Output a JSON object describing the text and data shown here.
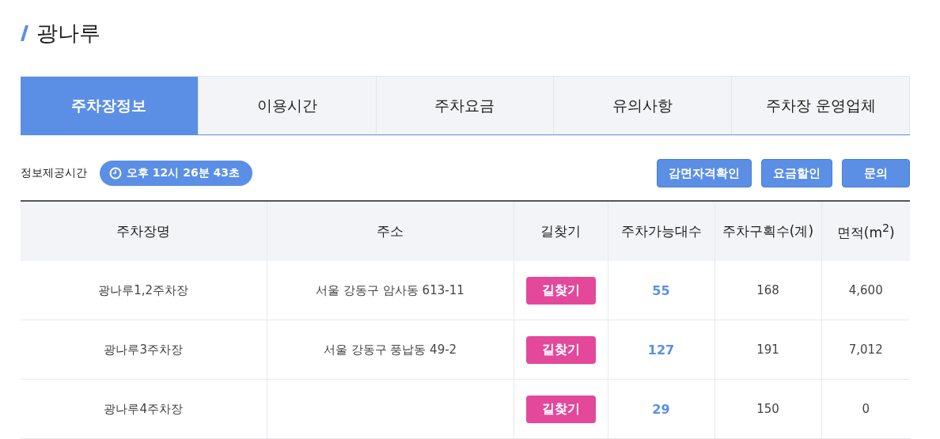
{
  "title": "광나루",
  "tabs": [
    {
      "label": "주차장정보",
      "selected": true
    },
    {
      "label": "이용시간",
      "selected": false
    },
    {
      "label": "주차요금",
      "selected": false
    },
    {
      "label": "유의사항",
      "selected": false
    },
    {
      "label": "주차장 운영업체",
      "selected": false
    }
  ],
  "info_time": {
    "label": "정보제공시간",
    "value": "오후 12시 26분 43초"
  },
  "buttons": [
    "감면자격확인",
    "요금할인",
    "문의"
  ],
  "table": {
    "columns": [
      "주차장명",
      "주소",
      "길찾기",
      "주차가능대수",
      "주차구획수(계)",
      "면적(m$^{2}$)"
    ],
    "rows": [
      {
        "name": "광나루1,2주차장",
        "address": "서울 강동구 암사동 613-11",
        "route": "길찾기",
        "available": "55",
        "spaces": "168",
        "area": "4,600"
      },
      {
        "name": "광나루3주차장",
        "address": "서울 강동구 풍납동 49-2",
        "route": "길찾기",
        "available": "127",
        "spaces": "191",
        "area": "7,012"
      },
      {
        "name": "광나루4주차장",
        "route": "길찾기",
        "available": "29",
        "spaces": "150",
        "area": "0"
      }
    ]
  }
}
